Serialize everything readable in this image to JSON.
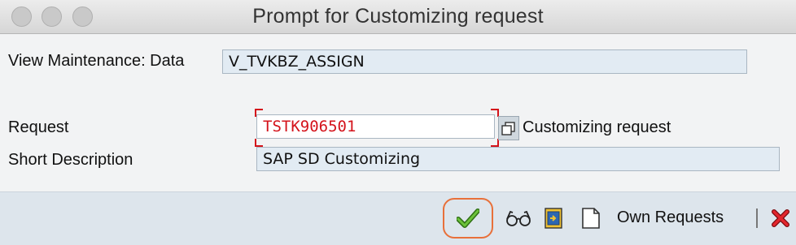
{
  "window": {
    "title": "Prompt for Customizing request"
  },
  "form": {
    "view_label": "View Maintenance: Data",
    "view_value": "V_TVKBZ_ASSIGN",
    "request_label": "Request",
    "request_value": "TSTK906501",
    "request_type": "Customizing request",
    "short_desc_label": "Short Description",
    "short_desc_value": "SAP SD Customizing"
  },
  "toolbar": {
    "own_requests_label": "Own Requests",
    "icons": [
      "checkmark-icon",
      "glasses-icon",
      "create-request-icon",
      "document-icon",
      "cancel-icon"
    ]
  },
  "colors": {
    "request_text": "#d4131b",
    "highlight_ring": "#e8703a",
    "check_green": "#3c8f1c",
    "cancel_red": "#d8141b"
  }
}
